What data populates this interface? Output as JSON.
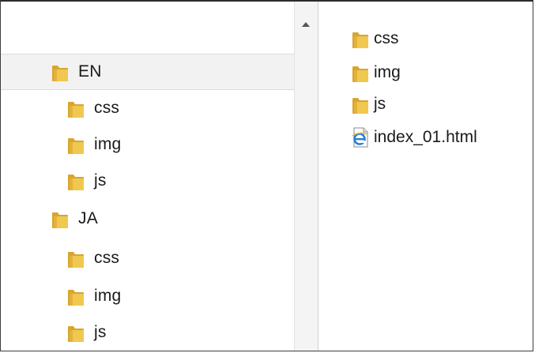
{
  "tree": {
    "items": [
      {
        "label": "EN",
        "level": 0,
        "selected": true
      },
      {
        "label": "css",
        "level": 1
      },
      {
        "label": "img",
        "level": 1
      },
      {
        "label": "js",
        "level": 1
      },
      {
        "label": "JA",
        "level": 0
      },
      {
        "label": "css",
        "level": 1
      },
      {
        "label": "img",
        "level": 1
      },
      {
        "label": "js",
        "level": 1
      }
    ]
  },
  "content": {
    "items": [
      {
        "label": "css",
        "icon": "folder-icon"
      },
      {
        "label": "img",
        "icon": "folder-icon"
      },
      {
        "label": "js",
        "icon": "folder-icon"
      },
      {
        "label": "index_01.html",
        "icon": "ie-html-file-icon"
      }
    ]
  },
  "colors": {
    "folder_main": "#f0c850",
    "folder_dark": "#d9a52e",
    "selection": "#f2f2f2",
    "ie_blue": "#2a7fd4"
  }
}
